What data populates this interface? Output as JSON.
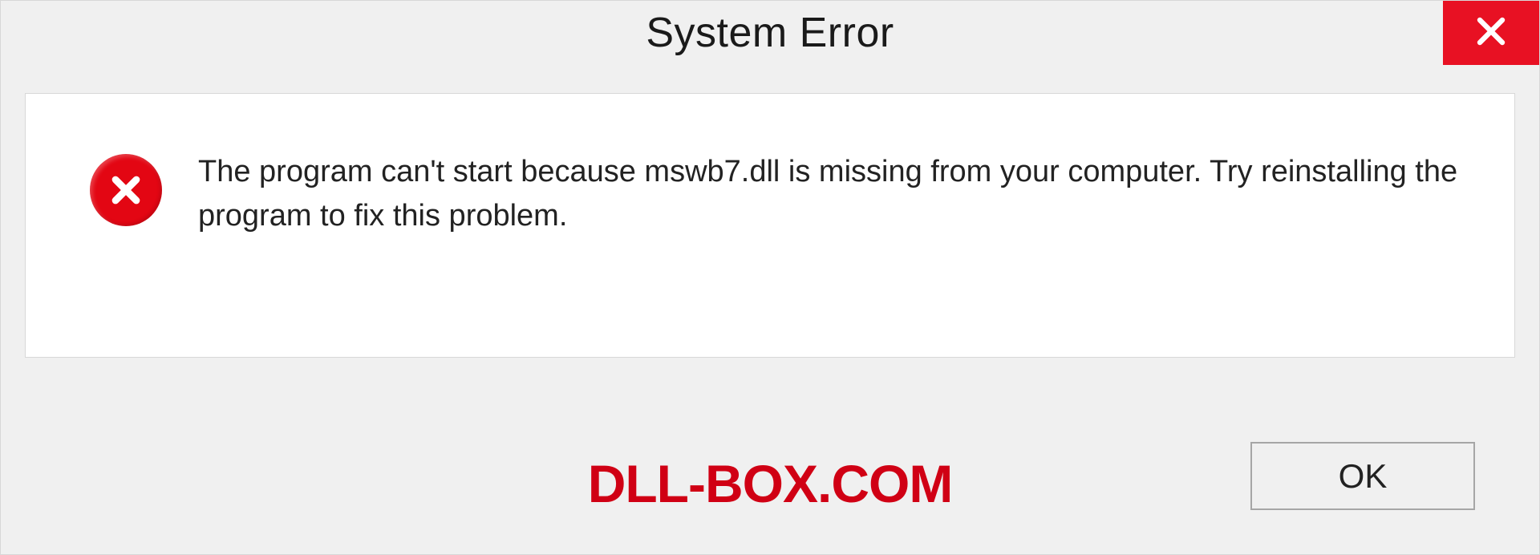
{
  "dialog": {
    "title": "System Error",
    "message": "The program can't start because mswb7.dll is missing from your computer. Try reinstalling the program to fix this problem.",
    "ok_label": "OK",
    "watermark": "DLL-BOX.COM",
    "colors": {
      "close_bg": "#e81123",
      "error_icon_bg": "#e30613",
      "watermark_color": "#d00014",
      "panel_bg": "#f0f0f0"
    }
  }
}
